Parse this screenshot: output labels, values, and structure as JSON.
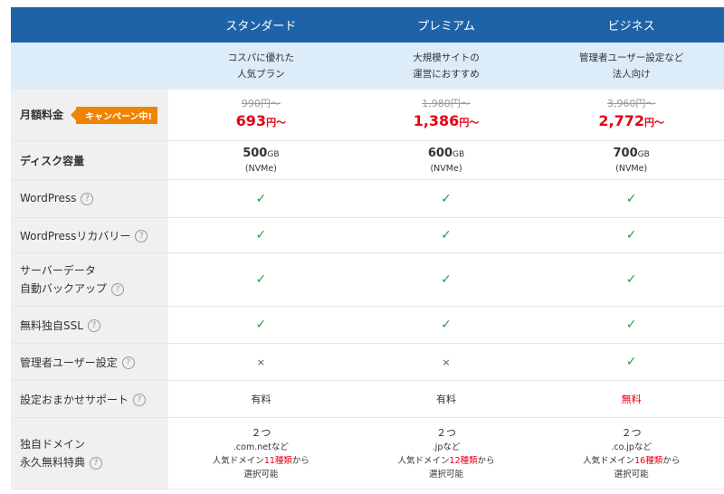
{
  "plans": [
    {
      "name": "スタンダード",
      "desc1": "コスパに優れた",
      "desc2": "人気プラン",
      "old_price": "990円〜",
      "new_price": "693",
      "new_unit": "円〜",
      "disk": "500",
      "disk_unit": "GB",
      "disk_type": "(NVMe)",
      "setup": "有料",
      "dom_count": "２つ",
      "dom_tld": ".com.netなど",
      "dom_pre": "人気ドメイン",
      "dom_num": "11種類",
      "dom_post": "から",
      "dom_sel": "選択可能"
    },
    {
      "name": "プレミアム",
      "desc1": "大規模サイトの",
      "desc2": "運営におすすめ",
      "old_price": "1,980円〜",
      "new_price": "1,386",
      "new_unit": "円〜",
      "disk": "600",
      "disk_unit": "GB",
      "disk_type": "(NVMe)",
      "setup": "有料",
      "dom_count": "２つ",
      "dom_tld": ".jpなど",
      "dom_pre": "人気ドメイン",
      "dom_num": "12種類",
      "dom_post": "から",
      "dom_sel": "選択可能"
    },
    {
      "name": "ビジネス",
      "desc1": "管理者ユーザー設定など",
      "desc2": "法人向け",
      "old_price": "3,960円〜",
      "new_price": "2,772",
      "new_unit": "円〜",
      "disk": "700",
      "disk_unit": "GB",
      "disk_type": "(NVMe)",
      "setup": "無料",
      "dom_count": "２つ",
      "dom_tld": ".co.jpなど",
      "dom_pre": "人気ドメイン",
      "dom_num": "16種類",
      "dom_post": "から",
      "dom_sel": "選択可能"
    }
  ],
  "labels": {
    "price": "月額料金",
    "campaign": "キャンペーン中!",
    "disk": "ディスク容量",
    "wordpress": "WordPress",
    "wp_recovery": "WordPressリカバリー",
    "backup1": "サーバーデータ",
    "backup2": "自動バックアップ",
    "ssl": "無料独自SSL",
    "admin": "管理者ユーザー設定",
    "setup": "設定おまかせサポート",
    "domain1": "独自ドメイン",
    "domain2": "永久無料特典"
  },
  "symbols": {
    "check": "✓",
    "cross": "×",
    "help": "?"
  },
  "features": {
    "wordpress": [
      true,
      true,
      true
    ],
    "wp_recovery": [
      true,
      true,
      true
    ],
    "backup": [
      true,
      true,
      true
    ],
    "ssl": [
      true,
      true,
      true
    ],
    "admin": [
      false,
      false,
      true
    ]
  },
  "colors": {
    "header": "#1e63a8",
    "desc_bg": "#dcecf8",
    "accent_red": "#e60012",
    "check_green": "#2c9c3a",
    "badge": "#f08300"
  }
}
